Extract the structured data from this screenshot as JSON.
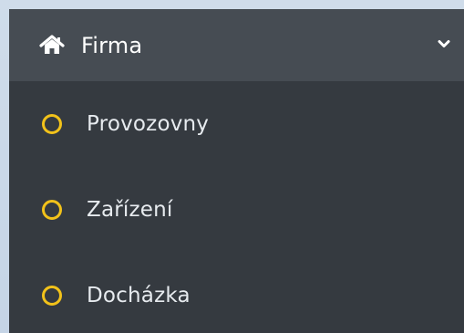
{
  "sidebar": {
    "group": {
      "label": "Firma",
      "icon": "home-icon",
      "expand_icon": "chevron-down-icon",
      "expanded": true
    },
    "items": [
      {
        "label": "Provozovny",
        "icon": "circle-outline-icon"
      },
      {
        "label": "Zařízení",
        "icon": "circle-outline-icon"
      },
      {
        "label": "Docházka",
        "icon": "circle-outline-icon"
      }
    ]
  },
  "colors": {
    "header_background": "#464c53",
    "sidebar_background": "#353a40",
    "item_icon": "#f2c21a",
    "text": "#ffffff",
    "page_background": "#cfdcea"
  }
}
